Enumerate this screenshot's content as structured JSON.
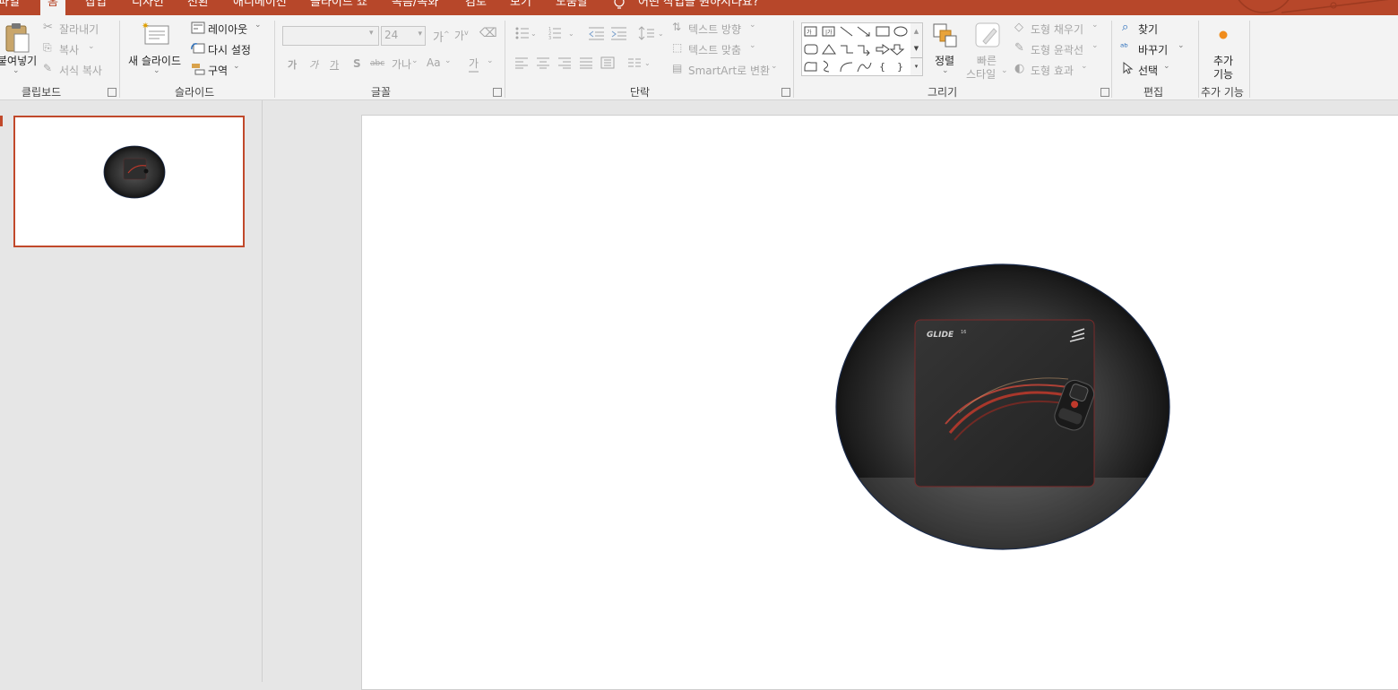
{
  "tabs": {
    "file": "파일",
    "home": "홈",
    "insert": "삽입",
    "design": "디자인",
    "transitions": "전환",
    "animations": "애니메이션",
    "slideshow": "슬라이드 쇼",
    "review": "검토",
    "recording": "녹음/녹화",
    "view": "보기",
    "help": "도움말",
    "tellme": "어떤 작업을 원하시나요?"
  },
  "clipboard": {
    "paste": "붙여넣기",
    "cut": "잘라내기",
    "copy": "복사",
    "format_painter": "서식 복사",
    "label": "클립보드"
  },
  "slides": {
    "new_slide": "새 슬라이드",
    "layout": "레이아웃",
    "reset": "다시 설정",
    "section": "구역",
    "label": "슬라이드"
  },
  "font": {
    "size": "24",
    "bold": "가",
    "italic": "가",
    "underline": "가",
    "shadow": "S",
    "strike": "abc",
    "spacing": "가나",
    "case": "Aa",
    "color": "가",
    "grow": "가",
    "shrink": "가",
    "label": "글꼴"
  },
  "paragraph": {
    "text_direction": "텍스트 방향",
    "align_text": "텍스트 맞춤",
    "smartart": "SmartArt로 변환",
    "label": "단락"
  },
  "drawing": {
    "arrange": "정렬",
    "quick_styles_1": "빠른",
    "quick_styles_2": "스타일",
    "shape_fill": "도형 채우기",
    "shape_outline": "도형 윤곽선",
    "shape_effects": "도형 효과",
    "label": "그리기"
  },
  "editing": {
    "find": "찾기",
    "replace": "바꾸기",
    "select": "선택",
    "label": "편집"
  },
  "addins": {
    "button_1": "추가",
    "button_2": "기능",
    "label": "추가 기능"
  },
  "slide_image": {
    "brand_text": "GLIDE",
    "brand_sup": "16"
  },
  "colors": {
    "accent": "#b7472a",
    "thumb_border": "#c1492b",
    "ribbon_bg": "#f3f3f3"
  }
}
